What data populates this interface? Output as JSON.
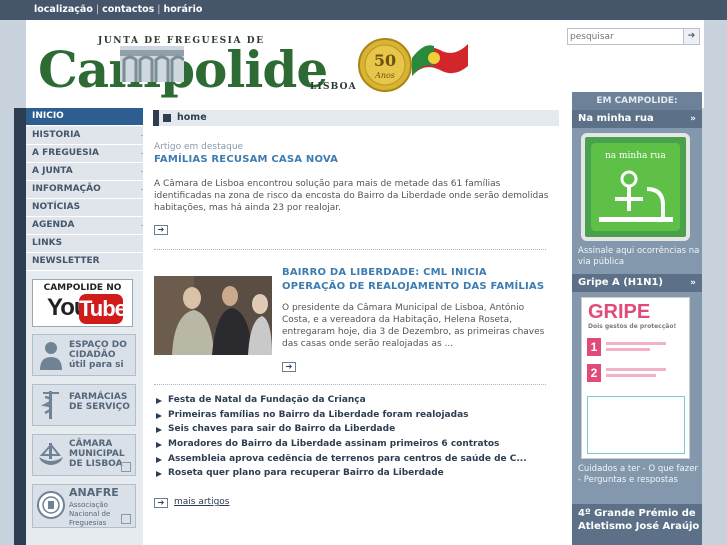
{
  "topbar": {
    "links": [
      "localização",
      "contactos",
      "horário"
    ],
    "separator": "|"
  },
  "header": {
    "logo_small": "JUNTA DE FREGUESIA DE",
    "logo_big": "Campolide",
    "logo_city": "LISBOA",
    "medal_text": "50 Anos"
  },
  "search": {
    "placeholder": "pesquisar",
    "button_glyph": "➔"
  },
  "nav": {
    "items": [
      {
        "label": "INICIO",
        "expand": ""
      },
      {
        "label": "HISTORIA",
        "expand": "+"
      },
      {
        "label": "A FREGUESIA",
        "expand": "+"
      },
      {
        "label": "A JUNTA",
        "expand": "+"
      },
      {
        "label": "INFORMAÇÃO",
        "expand": "+"
      },
      {
        "label": "NOTÍCIAS",
        "expand": ""
      },
      {
        "label": "AGENDA",
        "expand": "+"
      },
      {
        "label": "LINKS",
        "expand": ""
      },
      {
        "label": "NEWSLETTER",
        "expand": ""
      }
    ]
  },
  "promos": {
    "youtube_line1": "CAMPOLIDE NO",
    "youtube_you": "You",
    "youtube_tube": "Tube",
    "cidadao": "ESPAÇO DO CIDADÃO útil para si",
    "farmacias": "FARMÁCIAS DE SERVIÇO",
    "camara": "CÂMARA MUNICIPAL DE LISBOA",
    "anafre_title": "ANAFRE",
    "anafre_sub": "Associação Nacional de Freguesias"
  },
  "breadcrumb": {
    "label": "home"
  },
  "featured": {
    "tag": "Artigo em destaque",
    "title": "FAMÍLIAS RECUSAM CASA NOVA",
    "text": "A Câmara de Lisboa encontrou solução para mais de metade das 61 famílias identificadas na zona de risco da encosta do Bairro da Liberdade onde serão demolidas habitações, mas há ainda 23 por realojar."
  },
  "article2": {
    "title": "BAIRRO DA LIBERDADE: CML INICIA OPERAÇÃO DE REALOJAMENTO DAS FAMÍLIAS",
    "text": "O presidente da Câmara Municipal de Lisboa, António Costa, e a vereadora da Habitação, Helena Roseta, entregaram hoje, dia 3 de Dezembro, as primeiras chaves das casas onde serão realojadas as ..."
  },
  "news": [
    "Festa de Natal da Fundação da Criança",
    "Primeiras famílias no Bairro da Liberdade foram realojadas",
    "Seis chaves para sair do Bairro da Liberdade",
    "Moradores do Bairro da Liberdade assinam primeiros 6 contratos",
    "Assembleia aprova cedência de terrenos para centros de saúde de C...",
    "Roseta quer plano para recuperar Bairro da Liberdade"
  ],
  "more_label": "mais artigos",
  "right": {
    "head": "EM CAMPOLIDE:",
    "rua_title": "Na minha rua",
    "rua_img_text": "na minha rua",
    "rua_caption": "Assinale aqui ocorrências na via pública",
    "gripe_title": "Gripe A (H1N1)",
    "gripe_img_text": "GRIPE",
    "gripe_img_sub": "Dois gestos de protecção!",
    "gripe_caption": "Cuidados a ter - O que fazer - Perguntas e respostas",
    "premio_title": "4º Grande Prémio de Atletismo José Araújo",
    "dbl": "»"
  },
  "colors": {
    "nav_dark": "#2d3e52",
    "nav_active": "#2e5d8f",
    "link_blue": "#3d7cb1",
    "right_panel": "#8498ad"
  }
}
